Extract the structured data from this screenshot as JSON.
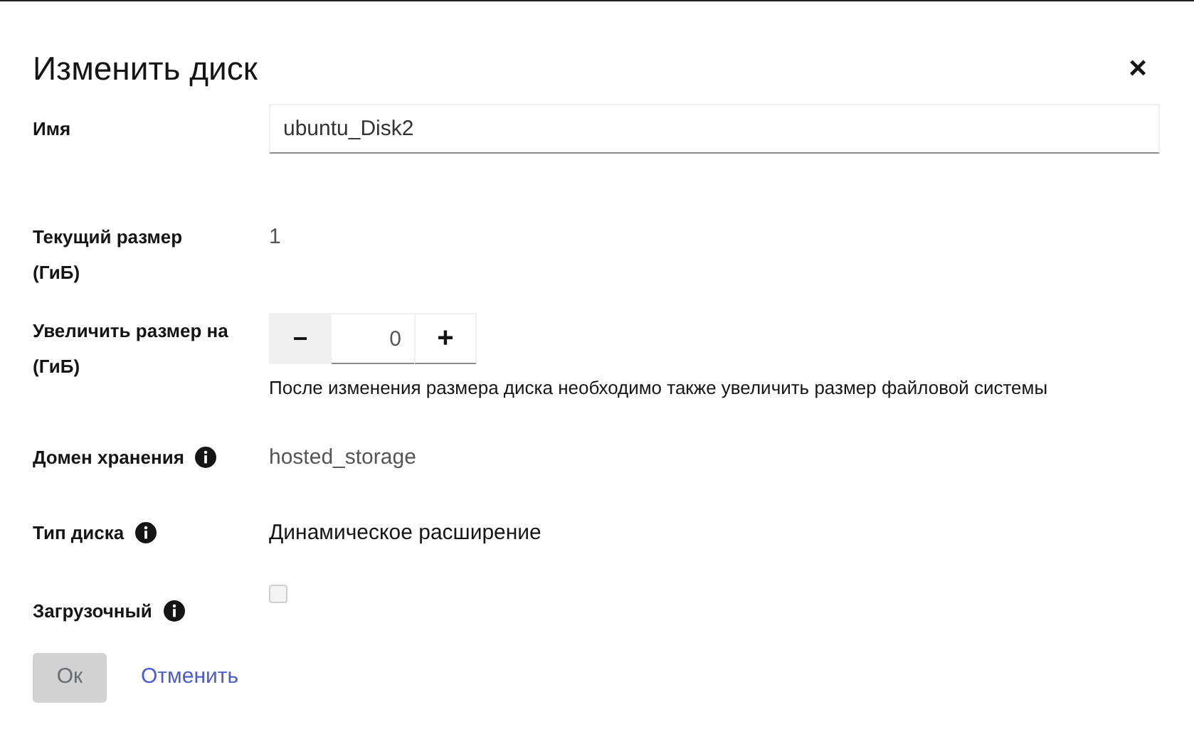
{
  "dialog": {
    "title": "Изменить диск",
    "close": "×"
  },
  "fields": [
    {
      "kind": "input",
      "label": "Имя",
      "value": "ubuntu_Disk2",
      "info": false
    },
    {
      "kind": "text",
      "label": "Текущий размер (ГиБ)",
      "value": "1",
      "info": false,
      "dark": false
    },
    {
      "kind": "spinner",
      "label": "Увеличить размер на (ГиБ)",
      "minus": "−",
      "value": "0",
      "plus": "+",
      "help": "После изменения размера диска необходимо также увеличить размер файловой системы",
      "info": false
    },
    {
      "kind": "text",
      "label": "Домен хранения",
      "value": "hosted_storage",
      "info": true,
      "dark": false
    },
    {
      "kind": "text",
      "label": "Тип диска",
      "value": "Динамическое расширение",
      "info": true,
      "dark": true
    },
    {
      "kind": "checkbox",
      "label": "Загрузочный",
      "checked": false,
      "disabled": true,
      "info": true
    }
  ],
  "buttons": [
    {
      "kind": "primary",
      "label": "Ок",
      "disabled": true
    },
    {
      "kind": "link",
      "label": "Отменить",
      "disabled": false
    }
  ]
}
